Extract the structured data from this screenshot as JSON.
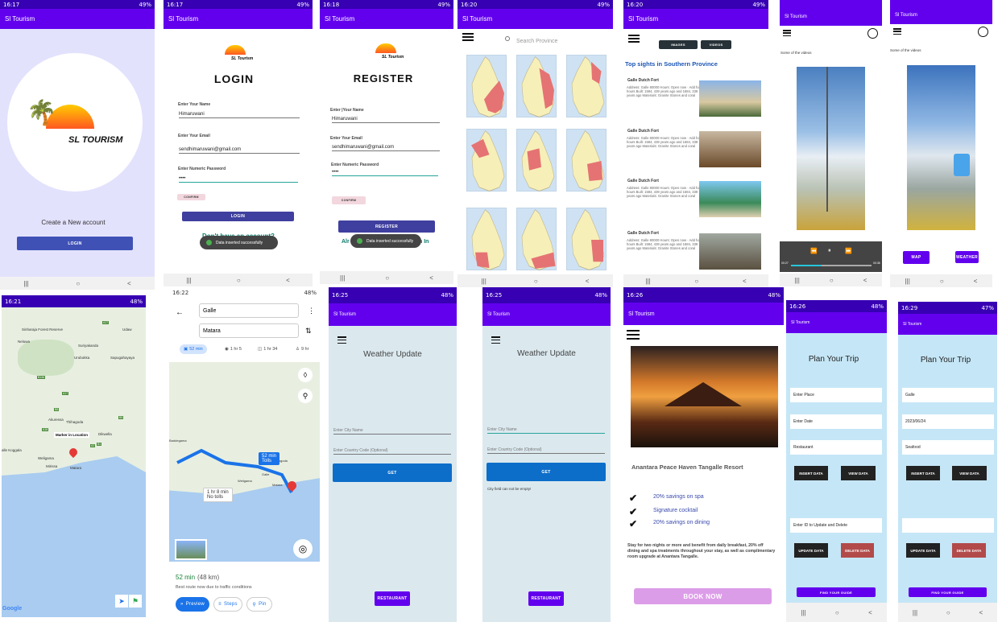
{
  "theme": {
    "purple": "#6200ee",
    "status_purple": "#3700b3",
    "blue_btn": "#3f51b5",
    "blue_get": "#0d6ec9",
    "map_red": "#e57373"
  },
  "s1": {
    "time": "16:17",
    "status": "49%",
    "app_title": "Sl Tourism",
    "logo_text": "SL TOURISM",
    "create": "Create a New account",
    "login_btn": "LOGIN"
  },
  "s2": {
    "time": "16:17",
    "status": "49%",
    "app_title": "Sl Tourism",
    "logo_text": "SL Tourism",
    "heading": "LOGIN",
    "name_label": "Enter Your Name",
    "name_value": "Himaruwani",
    "email_label": "Enter Your Email",
    "email_value": "sendhimaruwani@gmail.com",
    "pass_label": "Enter Numeric Password",
    "pass_value": "••••",
    "confirm": "CONFIRM",
    "login": "LOGIN",
    "account": "Don't have an account?",
    "toast": "Data inserted successfully"
  },
  "s3": {
    "time": "16:18",
    "status": "49%",
    "app_title": "Sl Tourism",
    "logo_text": "SL Tourism",
    "heading": "REGISTER",
    "name_label": "Enter |Your Name",
    "name_value": "Himaruwani",
    "email_label": "Enter Your Email",
    "email_value": "sendhimaruwani@gmail.com",
    "pass_label": "Enter Numeric Password",
    "pass_value": "••••",
    "confirm": "CONFIRM",
    "register": "REGISTER",
    "already": "Alr",
    "login_in": "n In",
    "toast": "Data inserted successfully"
  },
  "s4": {
    "time": "16:20",
    "status": "49%",
    "app_title": "Sl Tourism",
    "search_placeholder": "Search Province"
  },
  "s5": {
    "time": "16:20",
    "status": "49%",
    "app_title": "Sl Tourism",
    "tab_images": "IMAGES",
    "tab_videos": "VIDEOS",
    "heading": "Top sights in Southern Province",
    "sight_title": "Galle Dutch Fort",
    "sight_text": "Address: Galle 80000 Hours:  Open now · Add full hours   Built: 1584, 439 years ago and 1684, 339 years ago Materials: Granite Stones and coral"
  },
  "s6": {
    "app_title": "Sl Tourism",
    "caption": "Some of the videos",
    "time_start": "00:27",
    "time_end": "00:36"
  },
  "s7": {
    "app_title": "Sl Tourism",
    "caption": "Some of the videos",
    "map_btn": "MAP",
    "weather_btn": "WEATHER"
  },
  "s8": {
    "time": "16:21",
    "status": "48%",
    "marker": "Marker in Location",
    "places": [
      "Sinharaja Forest Reserve",
      "Udaw",
      "Neluwa",
      "Suriyakanda",
      "Urubokka",
      "Sapugahayaya",
      "Akuressa",
      "Thihagoda",
      "Dikwella",
      "Weligama",
      "Mirissa",
      "Matara",
      "alle Koggala"
    ],
    "road_codes": [
      "A17",
      "B146",
      "A17",
      "B8",
      "A18",
      "A2",
      "B1",
      "B5"
    ],
    "google": "Google"
  },
  "s9": {
    "time": "16:22",
    "status": "48%",
    "from": "Galle",
    "to": "Matara",
    "modes": [
      "52 min",
      "1 hr 5",
      "1 hr 34",
      "9 hr"
    ],
    "bubble_main": "52 min",
    "bubble_sub": "Tolls",
    "alt_main": "1 hr 8 min",
    "alt_sub": "No tolls",
    "duration": "52 min",
    "distance": "(48 km)",
    "route_note": "Best route now due to traffic conditions",
    "preview": "Preview",
    "steps": "Steps",
    "pin": "Pin",
    "map_labels": [
      "Baddegama",
      "Thihagoda",
      "Galle",
      "Weligama",
      "Matara"
    ]
  },
  "s10": {
    "time": "16:25",
    "status": "48%",
    "app_title": "Sl Tourism",
    "heading": "Weather Update",
    "city_placeholder": "Enter City Name",
    "country_placeholder": "Enter Country Code (Optional)",
    "get": "GET",
    "restaurant": "RESTAURANT"
  },
  "s11": {
    "time": "16:25",
    "status": "48%",
    "app_title": "Sl Tourism",
    "heading": "Weather Update",
    "city_placeholder": "Enter City Name",
    "country_placeholder": "Enter Country Code (Optional)",
    "get": "GET",
    "error": "City field can not be empty!",
    "restaurant": "RESTAURANT"
  },
  "s12": {
    "time": "16:26",
    "status": "48%",
    "app_title": "Sl Tourism",
    "resort": "Anantara Peace Haven Tangalle Resort",
    "offers": [
      "20% savings on spa",
      "Signature cocktail",
      "20% savings on dining"
    ],
    "description": "Stay for two nights or more and benefit from daily breakfast, 20% off dining and spa treatments throughout your stay, as well as complimentary room upgrade at Anantara Tangalle.",
    "book": "BOOK NOW"
  },
  "s13": {
    "time": "16:26",
    "status": "48%",
    "app_title": "Sl Tourism",
    "heading": "Plan Your Trip",
    "place": "Enter Place",
    "date": "Enter Date",
    "food": "Restaurant",
    "insert": "INSERT DATA",
    "view": "VIEW DATA",
    "id_placeholder": "Enter ID to Update and Delete",
    "update": "UPDATE DATA",
    "delete": "DELETE DATA",
    "guide": "FIND YOUR GUIDE"
  },
  "s14": {
    "time": "16:29",
    "status": "47%",
    "app_title": "Sl Tourism",
    "heading": "Plan Your Trip",
    "place": "Galle",
    "date": "2023/06/24",
    "food": "Seafood",
    "insert": "INSERT DATA",
    "view": "VIEW DATA",
    "update": "UPDATE DATA",
    "delete": "DELETE DATA",
    "guide": "FIND YOUR GUIDE"
  },
  "nav": {
    "recent": "|||",
    "home": "○",
    "back": "<"
  }
}
